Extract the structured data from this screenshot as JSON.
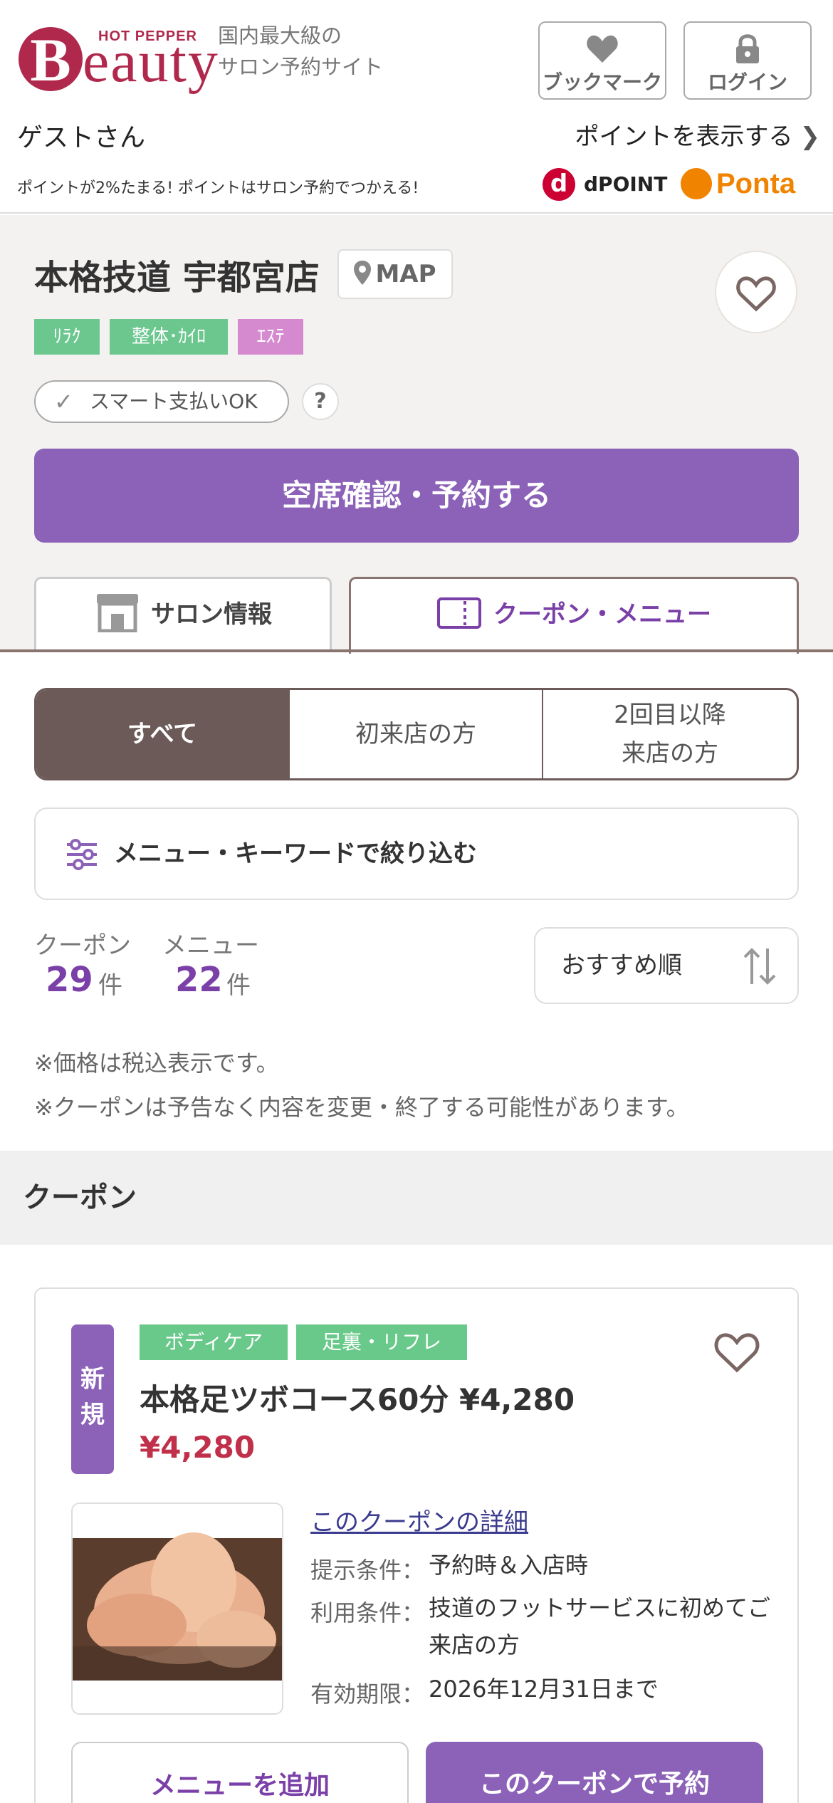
{
  "header": {
    "brand_top": "HOT PEPPER",
    "brand_initial": "B",
    "brand_rest": "eauty",
    "tagline_line1": "国内最大級の",
    "tagline_line2": "サロン予約サイト",
    "bookmark_label": "ブックマーク",
    "login_label": "ログイン",
    "guest_label": "ゲストさん",
    "points_link": "ポイントを表示する",
    "promo_text": "ポイントが2%たまる! ポイントはサロン予約でつかえる!",
    "dpoint_mark": "d",
    "dpoint_text": "POINT",
    "ponta_text": "Ponta"
  },
  "salon": {
    "name": "本格技道 宇都宮店",
    "map_label": "MAP",
    "tags": [
      {
        "label": "ﾘﾗｸ",
        "color": "#6cc78f"
      },
      {
        "label": "整体･ｶｲﾛ",
        "color": "#6cc78f"
      },
      {
        "label": "ｴｽﾃ",
        "color": "#d58ad0"
      }
    ],
    "smart_pay": "スマート支払いOK",
    "help_mark": "?",
    "reserve_button": "空席確認・予約する",
    "tabs": {
      "info": "サロン情報",
      "coupon": "クーポン・メニュー"
    }
  },
  "filters": {
    "segments": [
      "すべて",
      "初来店の方",
      "2回目以降\n来店の方"
    ],
    "keyword_filter": "メニュー・キーワードで絞り込む",
    "coupon_label": "クーポン",
    "coupon_count": "29",
    "menu_label": "メニュー",
    "menu_count": "22",
    "count_unit": "件",
    "sort_label": "おすすめ順"
  },
  "notes": {
    "tax": "※価格は税込表示です。",
    "change": "※クーポンは予告なく内容を変更・終了する可能性があります。"
  },
  "coupon_section": {
    "heading": "クーポン",
    "card": {
      "badge": "新規",
      "tags": [
        "ボディケア",
        "足裏・リフレ"
      ],
      "title": "本格足ツボコース60分 ¥4,280",
      "price": "¥4,280",
      "detail_link": "このクーポンの詳細",
      "presentation_label": "提示条件：",
      "presentation_value": "予約時＆入店時",
      "usage_label": "利用条件：",
      "usage_value": "技道のフットサービスに初めてご来店の方",
      "expiry_label": "有効期限：",
      "expiry_value": "2026年12月31日まで",
      "add_button": "メニューを追加",
      "book_button": "このクーポンで予約"
    }
  },
  "colors": {
    "brand": "#b0294d",
    "accent_purple": "#8c62b8",
    "count_purple": "#7b3fa8",
    "price_red": "#c0304a",
    "segment_active": "#6b5a58"
  }
}
